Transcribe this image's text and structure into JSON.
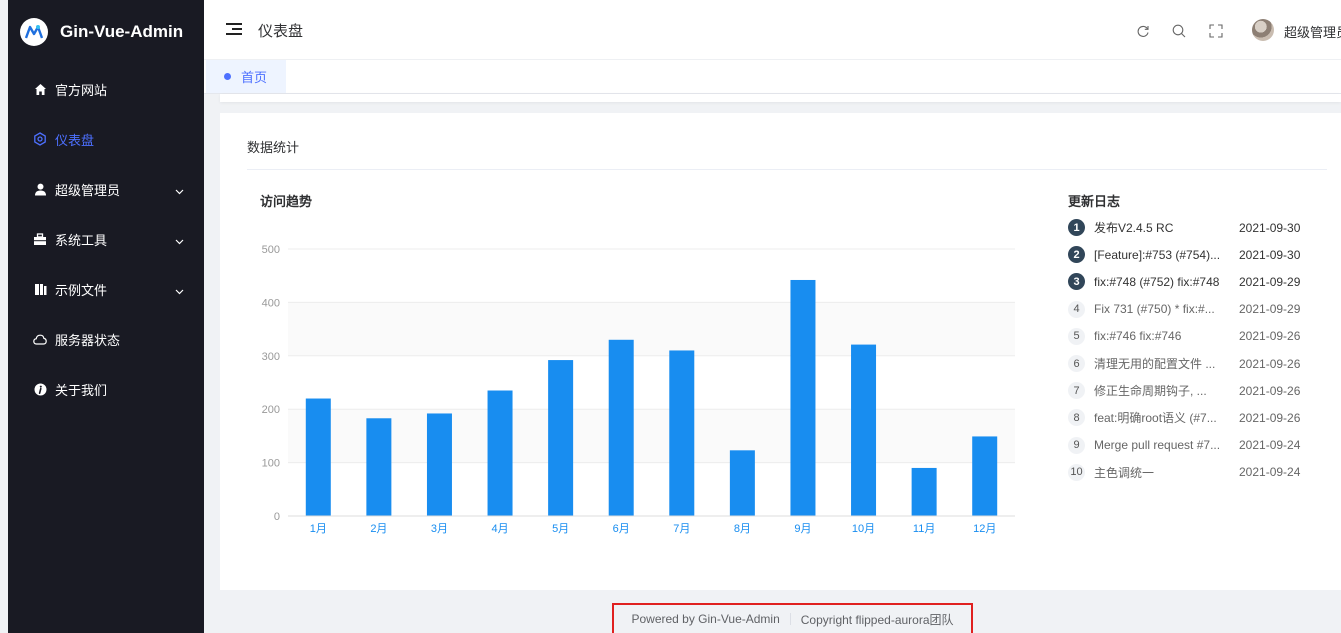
{
  "app": {
    "title": "Gin-Vue-Admin"
  },
  "sidebar": {
    "items": [
      {
        "label": "官方网站",
        "icon": "home-icon",
        "active": false,
        "has_submenu": false
      },
      {
        "label": "仪表盘",
        "icon": "dashboard-icon",
        "active": true,
        "has_submenu": false
      },
      {
        "label": "超级管理员",
        "icon": "user-icon",
        "active": false,
        "has_submenu": true
      },
      {
        "label": "系统工具",
        "icon": "briefcase-icon",
        "active": false,
        "has_submenu": true
      },
      {
        "label": "示例文件",
        "icon": "files-icon",
        "active": false,
        "has_submenu": true
      },
      {
        "label": "服务器状态",
        "icon": "cloud-icon",
        "active": false,
        "has_submenu": false
      },
      {
        "label": "关于我们",
        "icon": "info-icon",
        "active": false,
        "has_submenu": false
      }
    ]
  },
  "header": {
    "title": "仪表盘",
    "user_name": "超级管理员"
  },
  "tabs": [
    {
      "label": "首页",
      "active": true
    }
  ],
  "card": {
    "title": "数据统计"
  },
  "chart_data": {
    "type": "bar",
    "title": "访问趋势",
    "categories": [
      "1月",
      "2月",
      "3月",
      "4月",
      "5月",
      "6月",
      "7月",
      "8月",
      "9月",
      "10月",
      "11月",
      "12月"
    ],
    "values": [
      220,
      183,
      192,
      235,
      292,
      330,
      310,
      123,
      442,
      321,
      90,
      149
    ],
    "ylim": [
      0,
      500
    ],
    "yticks": [
      "0",
      "100",
      "200",
      "300",
      "400",
      "500"
    ],
    "bar_color": "#188df0",
    "grid": true
  },
  "changelog": {
    "title": "更新日志",
    "entries": [
      {
        "num": "1",
        "msg": "发布V2.4.5 RC",
        "date": "2021-09-30"
      },
      {
        "num": "2",
        "msg": "[Feature]:#753 (#754)...",
        "date": "2021-09-30"
      },
      {
        "num": "3",
        "msg": "fix:#748 (#752) fix:#748",
        "date": "2021-09-29"
      },
      {
        "num": "4",
        "msg": "Fix 731 (#750) * fix:#...",
        "date": "2021-09-29"
      },
      {
        "num": "5",
        "msg": "fix:#746 fix:#746",
        "date": "2021-09-26"
      },
      {
        "num": "6",
        "msg": "清理无用的配置文件 ...",
        "date": "2021-09-26"
      },
      {
        "num": "7",
        "msg": "修正生命周期钩子, ...",
        "date": "2021-09-26"
      },
      {
        "num": "8",
        "msg": "feat:明确root语义 (#7...",
        "date": "2021-09-26"
      },
      {
        "num": "9",
        "msg": "Merge pull request #7...",
        "date": "2021-09-24"
      },
      {
        "num": "10",
        "msg": "主色调统一",
        "date": "2021-09-24"
      }
    ]
  },
  "footer": {
    "powered": "Powered by Gin-Vue-Admin",
    "copyright": "Copyright flipped-aurora团队"
  },
  "colors": {
    "accent": "#4d70ff",
    "sidebar_bg": "#191a23",
    "bar": "#188df0"
  }
}
